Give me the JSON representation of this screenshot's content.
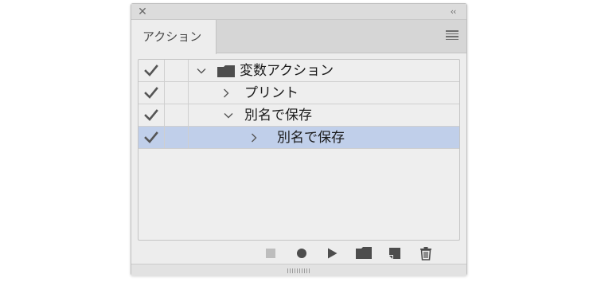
{
  "panel": {
    "close_glyph": "✕",
    "collapse_glyph": "‹‹",
    "tab_label": "アクション",
    "menu_icon": "panel-menu-icon"
  },
  "actions": [
    {
      "label": "変数アクション",
      "checked": true,
      "expanded": true,
      "type": "set",
      "level": 0
    },
    {
      "label": "プリント",
      "checked": true,
      "expanded": false,
      "type": "action",
      "level": 1
    },
    {
      "label": "別名で保存",
      "checked": true,
      "expanded": true,
      "type": "action",
      "level": 1
    },
    {
      "label": "別名で保存",
      "checked": true,
      "expanded": false,
      "type": "command",
      "level": 2,
      "selected": true
    }
  ],
  "toolbar": [
    "stop-icon",
    "record-icon",
    "play-icon",
    "new-set-icon",
    "new-action-icon",
    "trash-icon"
  ],
  "colors": {
    "selection": "#c0cfea",
    "panel_bg": "#ededed",
    "icon": "#555555"
  }
}
